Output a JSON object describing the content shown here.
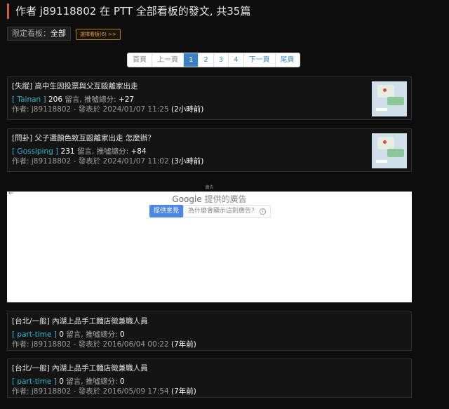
{
  "header": {
    "title": "作者 j89118802 在 PTT 全部看板的發文, 共35篇"
  },
  "filter": {
    "label": "限定看板：",
    "value": "全部",
    "select_button": "選擇看板(6) >>"
  },
  "pager": {
    "items": [
      "首頁",
      "上一頁",
      "1",
      "2",
      "3",
      "4",
      "下一頁",
      "尾頁"
    ],
    "active": "1"
  },
  "posts": [
    {
      "title": "[失蹤] 高中生因投票與父互毆離家出走",
      "board": "[ Tainan ]",
      "comments": "206",
      "comments_label": "留言, 推噓總分:",
      "score": "+27",
      "author_line": "作者: j89118802 - 發表於 2024/01/07 11:25",
      "ago": "(2小時前)"
    },
    {
      "title": "[問卦] 父子選顏色致互毆離家出走 怎麼辦？",
      "board": "[ Gossiping ]",
      "comments": "231",
      "comments_label": "留言, 推噓總分:",
      "score": "+84",
      "author_line": "作者: j89118802 - 發表於 2024/01/07 11:02",
      "ago": "(3小時前)"
    },
    {
      "title": "[台北/一般] 內湖上品手工麵店徵兼職人員",
      "board": "[ part-time ]",
      "comments": "0",
      "comments_label": "留言, 推噓總分:",
      "score": "0",
      "author_line": "作者: j89118802 - 發表於 2016/06/04 00:22",
      "ago": "(7年前)"
    },
    {
      "title": "[台北/一般] 內湖上品手工麵店徵兼職人員",
      "board": "[ part-time ]",
      "comments": "0",
      "comments_label": "留言, 推噓總分:",
      "score": "0",
      "author_line": "作者: j89118802 - 發表於 2016/05/09 17:54",
      "ago": "(7年前)"
    }
  ],
  "ad": {
    "label": "廣告",
    "brand": "Google",
    "brand_suffix": "提供的廣告",
    "feedback": "提供意見",
    "why": "為什麼會顯示這則廣告？",
    "info_glyph": "i",
    "back_glyph": "←"
  }
}
